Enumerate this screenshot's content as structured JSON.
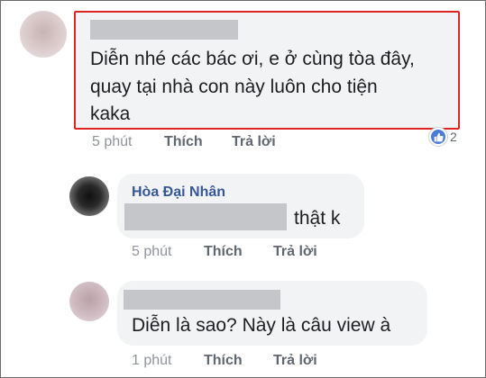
{
  "comments": [
    {
      "text_lines": [
        "Diễn nhé các bác ơi, e ở cùng tòa đây,",
        "quay tại nhà con này luôn cho tiện",
        "kaka"
      ],
      "time": "5 phút",
      "like_label": "Thích",
      "reply_label": "Trả lời",
      "reaction_count": "2",
      "highlight_color": "#e02424"
    },
    {
      "author": "Hòa Đại Nhân",
      "text": "thật k",
      "time": "5 phút",
      "like_label": "Thích",
      "reply_label": "Trả lời"
    },
    {
      "text": "Diễn là sao?  Này là câu view à",
      "time": "1 phút",
      "like_label": "Thích",
      "reply_label": "Trả lời"
    }
  ],
  "icons": {
    "reaction": "like-icon"
  },
  "colors": {
    "author_name": "#365899",
    "bubble": "#f2f3f5",
    "like_reaction": "#4b7bd8"
  }
}
